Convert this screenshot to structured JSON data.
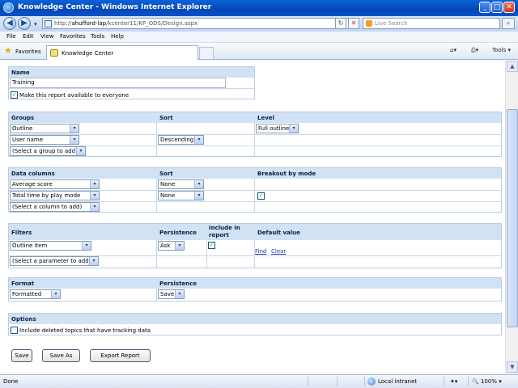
{
  "window": {
    "title": "Knowledge Center - Windows Internet Explorer",
    "minimize": "_",
    "maximize": "□",
    "close": "✕"
  },
  "address": {
    "url_prefix": "http://",
    "url_host": "ahufford-lap",
    "url_path": "/kcenter11/KP_ODS/Design.aspx",
    "search_placeholder": "Live Search",
    "refresh_glyph": "↻",
    "stop_glyph": "✕",
    "back_glyph": "◀",
    "forward_glyph": "▶",
    "search_glyph": "⌕"
  },
  "menu": [
    "File",
    "Edit",
    "View",
    "Favorites",
    "Tools",
    "Help"
  ],
  "favbar": {
    "favorites_label": "Favorites",
    "tab_label": "Knowledge Center",
    "tools_label": "Tools"
  },
  "name_section": {
    "header": "Name",
    "value": "Training",
    "checkbox_label": "Make this report available to everyone",
    "checked": "✓"
  },
  "groups_section": {
    "headers": {
      "groups": "Groups",
      "sort": "Sort",
      "level": "Level"
    },
    "rows": [
      {
        "group": "Outline",
        "sort": "",
        "level": "Full outline"
      },
      {
        "group": "User name",
        "sort": "Descending",
        "level": ""
      },
      {
        "group": "(Select a group to add)",
        "sort": "",
        "level": ""
      }
    ]
  },
  "columns_section": {
    "headers": {
      "columns": "Data columns",
      "sort": "Sort",
      "breakout": "Breakout by mode"
    },
    "rows": [
      {
        "column": "Average score",
        "sort": "None",
        "breakout": false
      },
      {
        "column": "Total time by play mode",
        "sort": "None",
        "breakout": true
      },
      {
        "column": "(Select a column to add)",
        "sort": "",
        "breakout": false
      }
    ],
    "checked": "✓"
  },
  "filters_section": {
    "headers": {
      "filters": "Filters",
      "persistence": "Persistence",
      "include": "Include in report",
      "default": "Default value"
    },
    "rows": [
      {
        "filter": "Outline item",
        "persistence": "Ask",
        "include": true,
        "find": "Find",
        "clear": "Clear"
      },
      {
        "filter": "(Select a parameter to add)"
      }
    ],
    "checked": "✓"
  },
  "format_section": {
    "headers": {
      "format": "Format",
      "persistence": "Persistence"
    },
    "format_value": "Formatted",
    "persistence_value": "Save"
  },
  "options_section": {
    "header": "Options",
    "checkbox_label": "Include deleted topics that have tracking data",
    "checked": ""
  },
  "buttons": {
    "save": "Save",
    "save_as": "Save As",
    "export": "Export Report"
  },
  "status": {
    "left": "Done",
    "zone": "Local intranet",
    "zoom": "100%"
  },
  "dropdown_glyph": "▾"
}
